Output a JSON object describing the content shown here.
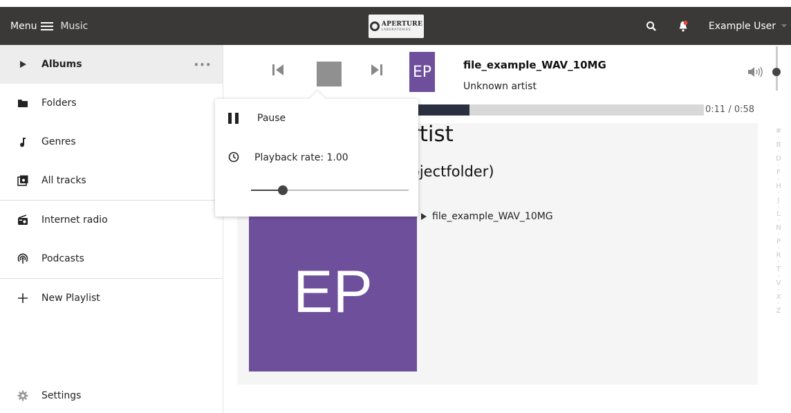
{
  "header": {
    "menu_label": "Menu",
    "app_name": "Music",
    "logo_text": "APERTURE",
    "logo_sub": "LABORATORIES",
    "user_name": "Example User",
    "icons": [
      "search-icon",
      "notification-icon",
      "chevron-down-icon"
    ]
  },
  "sidebar": {
    "items": [
      {
        "label": "Albums",
        "icon": "play-triangle-icon",
        "active": true,
        "more": "•••"
      },
      {
        "label": "Folders",
        "icon": "folder-icon"
      },
      {
        "label": "Genres",
        "icon": "music-note-icon"
      },
      {
        "label": "All tracks",
        "icon": "library-icon"
      },
      {
        "label": "Internet radio",
        "icon": "radio-icon"
      },
      {
        "label": "Podcasts",
        "icon": "podcast-icon"
      },
      {
        "label": "New Playlist",
        "icon": "plus-icon"
      }
    ],
    "settings_label": "Settings"
  },
  "player": {
    "cover_initials": "EP",
    "track_title": "file_example_WAV_10MG",
    "artist": "Unknown artist",
    "time": "0:11 / 0:58",
    "progress_fraction": 0.19,
    "volume_fraction": 0.5
  },
  "album": {
    "title_partial": "rtist",
    "subtitle_partial": "ojectfolder)",
    "cover_initials": "EP",
    "tracks": [
      "file_example_WAV_10MG"
    ]
  },
  "alphabet_index": [
    "#",
    "B",
    "D",
    "F",
    "H",
    "J",
    "L",
    "N",
    "P",
    "R",
    "T",
    "V",
    "X",
    "Z"
  ],
  "popup": {
    "pause_label": "Pause",
    "rate_label": "Playback rate: 1.00",
    "rate_slider_fraction": 0.2
  },
  "colors": {
    "header_bg": "#3a3937",
    "accent_purple": "#6e4f9c",
    "notification_red": "#e8473b"
  }
}
